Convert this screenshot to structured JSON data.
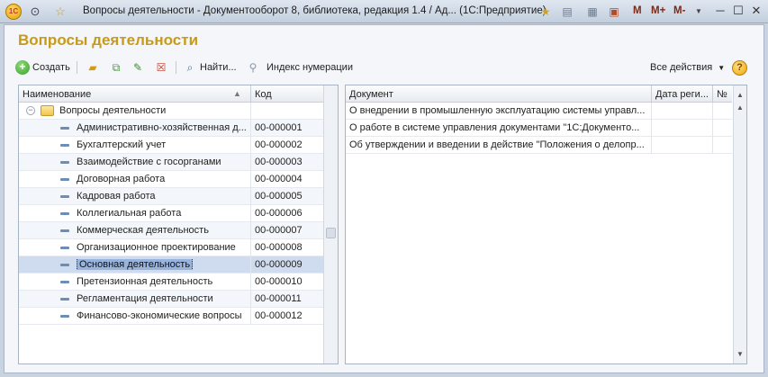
{
  "window": {
    "title": "Вопросы деятельности - Документооборот 8, библиотека, редакция 1.4 / Ад...  (1С:Предприятие)",
    "logo": "1С",
    "memory_buttons": [
      "M",
      "M+",
      "M-"
    ],
    "icons": [
      "menu-icon",
      "star-icon",
      "favorites-icon",
      "history-icon",
      "calculator-icon",
      "calendar-icon",
      "minimize-icon",
      "maximize-icon",
      "close-icon"
    ]
  },
  "page": {
    "title": "Вопросы деятельности"
  },
  "toolbar": {
    "create_label": "Создать",
    "find_label": "Найти...",
    "index_label": "Индекс нумерации",
    "all_actions_label": "Все действия",
    "help_label": "?"
  },
  "left_table": {
    "col_name": "Наименование",
    "col_code": "Код",
    "root": "Вопросы деятельности",
    "rows": [
      {
        "name": "Административно-хозяйственная д...",
        "code": "00-000001"
      },
      {
        "name": "Бухгалтерский учет",
        "code": "00-000002"
      },
      {
        "name": "Взаимодействие с госорганами",
        "code": "00-000003"
      },
      {
        "name": "Договорная работа",
        "code": "00-000004"
      },
      {
        "name": "Кадровая работа",
        "code": "00-000005"
      },
      {
        "name": "Коллегиальная работа",
        "code": "00-000006"
      },
      {
        "name": "Коммерческая деятельность",
        "code": "00-000007"
      },
      {
        "name": "Организационное проектирование",
        "code": "00-000008"
      },
      {
        "name": "Основная деятельность",
        "code": "00-000009"
      },
      {
        "name": "Претензионная деятельность",
        "code": "00-000010"
      },
      {
        "name": "Регламентация деятельности",
        "code": "00-000011"
      },
      {
        "name": "Финансово-экономические вопросы",
        "code": "00-000012"
      }
    ]
  },
  "right_table": {
    "col_doc": "Документ",
    "col_date": "Дата реги...",
    "col_num": "№",
    "rows": [
      {
        "doc": "О внедрении в промышленную эксплуатацию системы управл..."
      },
      {
        "doc": "О работе в системе управления документами \"1С:Документо..."
      },
      {
        "doc": "Об утверждении и введении в действие \"Положения о делопр..."
      }
    ]
  },
  "colors": {
    "title_accent": "#c89a17",
    "selection": "#98b4dc"
  }
}
